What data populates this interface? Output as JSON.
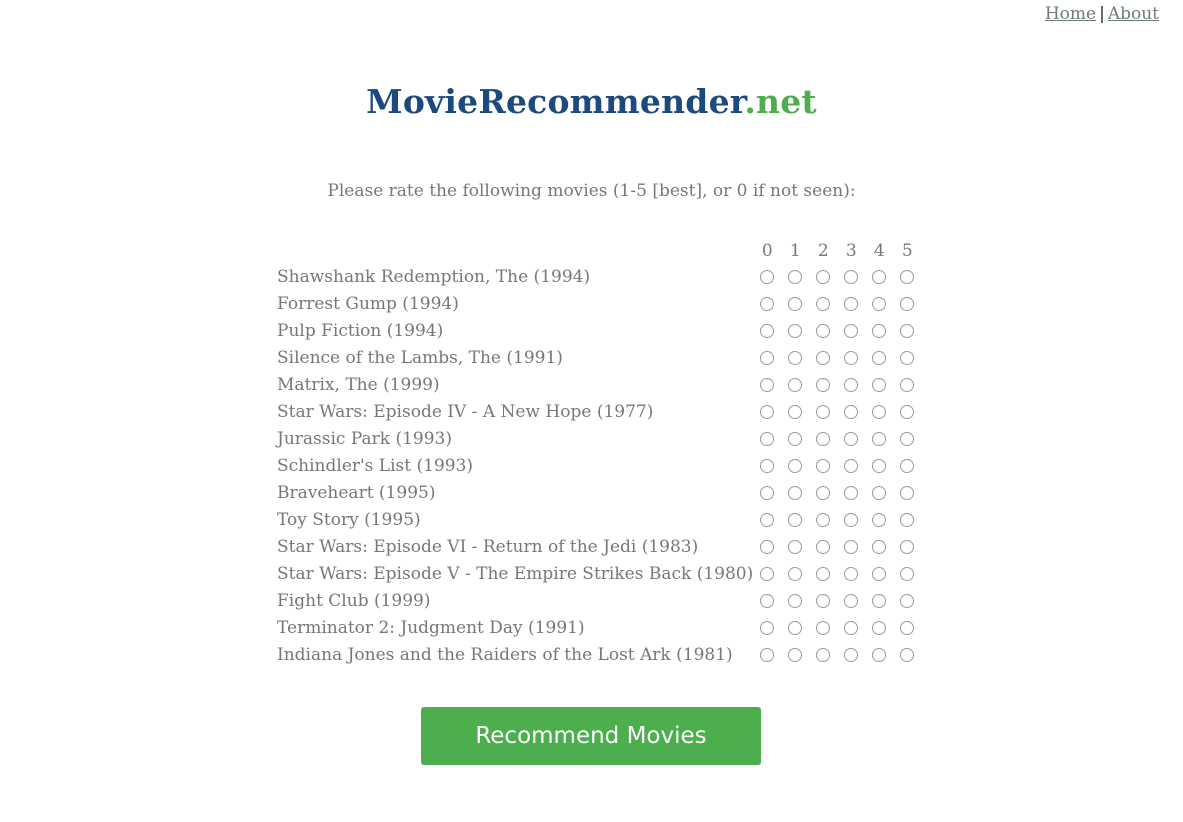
{
  "nav": {
    "home_label": "Home",
    "separator": "|",
    "about_label": "About"
  },
  "header": {
    "brand": "MovieRecommender",
    "tld": ".net"
  },
  "instructions": "Please rate the following movies (1-5 [best], or 0 if not seen):",
  "rating_scale": [
    "0",
    "1",
    "2",
    "3",
    "4",
    "5"
  ],
  "movies": [
    "Shawshank Redemption, The (1994)",
    "Forrest Gump (1994)",
    "Pulp Fiction (1994)",
    "Silence of the Lambs, The (1991)",
    "Matrix, The (1999)",
    "Star Wars: Episode IV - A New Hope (1977)",
    "Jurassic Park (1993)",
    "Schindler's List (1993)",
    "Braveheart (1995)",
    "Toy Story (1995)",
    "Star Wars: Episode VI - Return of the Jedi (1983)",
    "Star Wars: Episode V - The Empire Strikes Back (1980)",
    "Fight Club (1999)",
    "Terminator 2: Judgment Day (1991)",
    "Indiana Jones and the Raiders of the Lost Ark (1981)"
  ],
  "submit_label": "Recommend Movies",
  "colors": {
    "brand": "#1c4a7e",
    "accent": "#4cae4c",
    "text_muted": "#777777"
  }
}
